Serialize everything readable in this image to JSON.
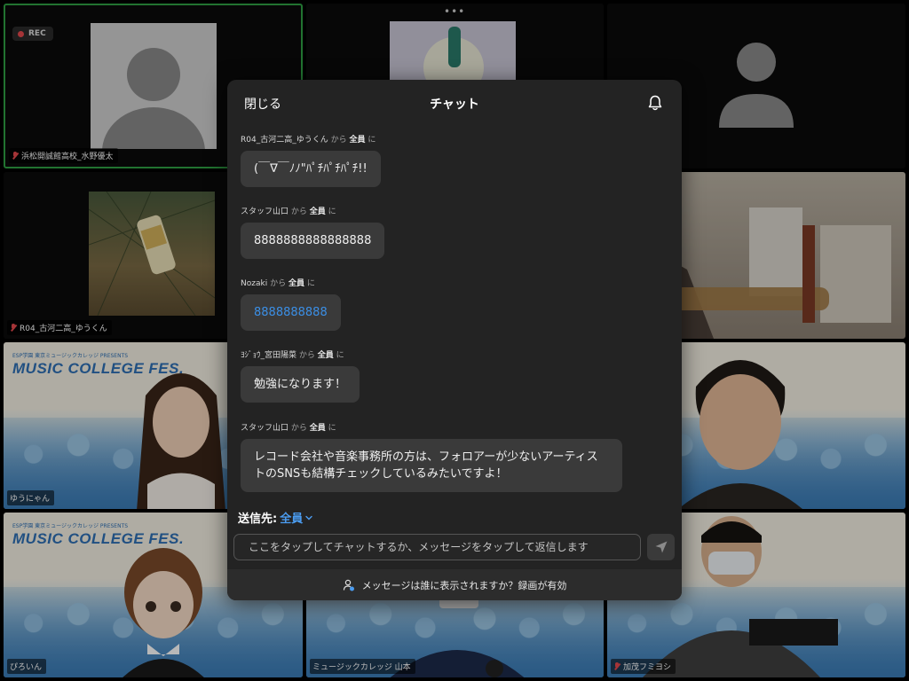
{
  "grid": {
    "rec_label": "REC",
    "tiles": [
      {
        "name": "浜松開誠館高校_水野優太"
      },
      {
        "name": "R04_古河二高_ゆうくん"
      },
      {
        "name": "ゆうにゃん"
      },
      {
        "name": "ぴろいん"
      },
      {
        "name": "ミュージックカレッジ 山本"
      },
      {
        "name": "加茂フミヨシ"
      }
    ],
    "fest_title": "MUSIC COLLEGE FES.",
    "fest_sub": "ESP学園 東京ミュージックカレッジ PRESENTS"
  },
  "chat": {
    "close_label": "閉じる",
    "title": "チャット",
    "messages": [
      {
        "sender": "R04_古河二高_ゆうくん",
        "from": "から",
        "to": "全員",
        "ni": "に",
        "text": "(￣∇￣ﾉﾉ\"ﾊﾟﾁﾊﾟﾁﾊﾟﾁ!!"
      },
      {
        "sender": "スタッフ山口",
        "from": "から",
        "to": "全員",
        "ni": "に",
        "text": "8888888888888888"
      },
      {
        "sender": "Nozaki",
        "from": "から",
        "to": "全員",
        "ni": "に",
        "text": "8888888888"
      },
      {
        "sender": "ﾖｼﾞｮｳ_宮田陽菜",
        "from": "から",
        "to": "全員",
        "ni": "に",
        "text": "勉強になります！"
      },
      {
        "sender": "スタッフ山口",
        "from": "から",
        "to": "全員",
        "ni": "に",
        "text_line1": "レコード会社や音楽事務所の方は、フォロアーが少ないアーティス",
        "text_line2": "トのSNSも結構チェックしているみたいですよ！"
      }
    ],
    "to_label": "送信先:",
    "to_target": "全員",
    "input_placeholder": "ここをタップしてチャットするか、メッセージをタップして返信します",
    "footer_text": "メッセージは誰に表示されますか？録画が有効"
  },
  "colors": {
    "panel_bg": "#232323",
    "bubble_bg": "#3a3a3a",
    "link_blue": "#3b8fe6",
    "accent_blue": "#4b9cf0",
    "active_speaker_green": "#2ea043",
    "mic_off_red": "#e5484d"
  }
}
